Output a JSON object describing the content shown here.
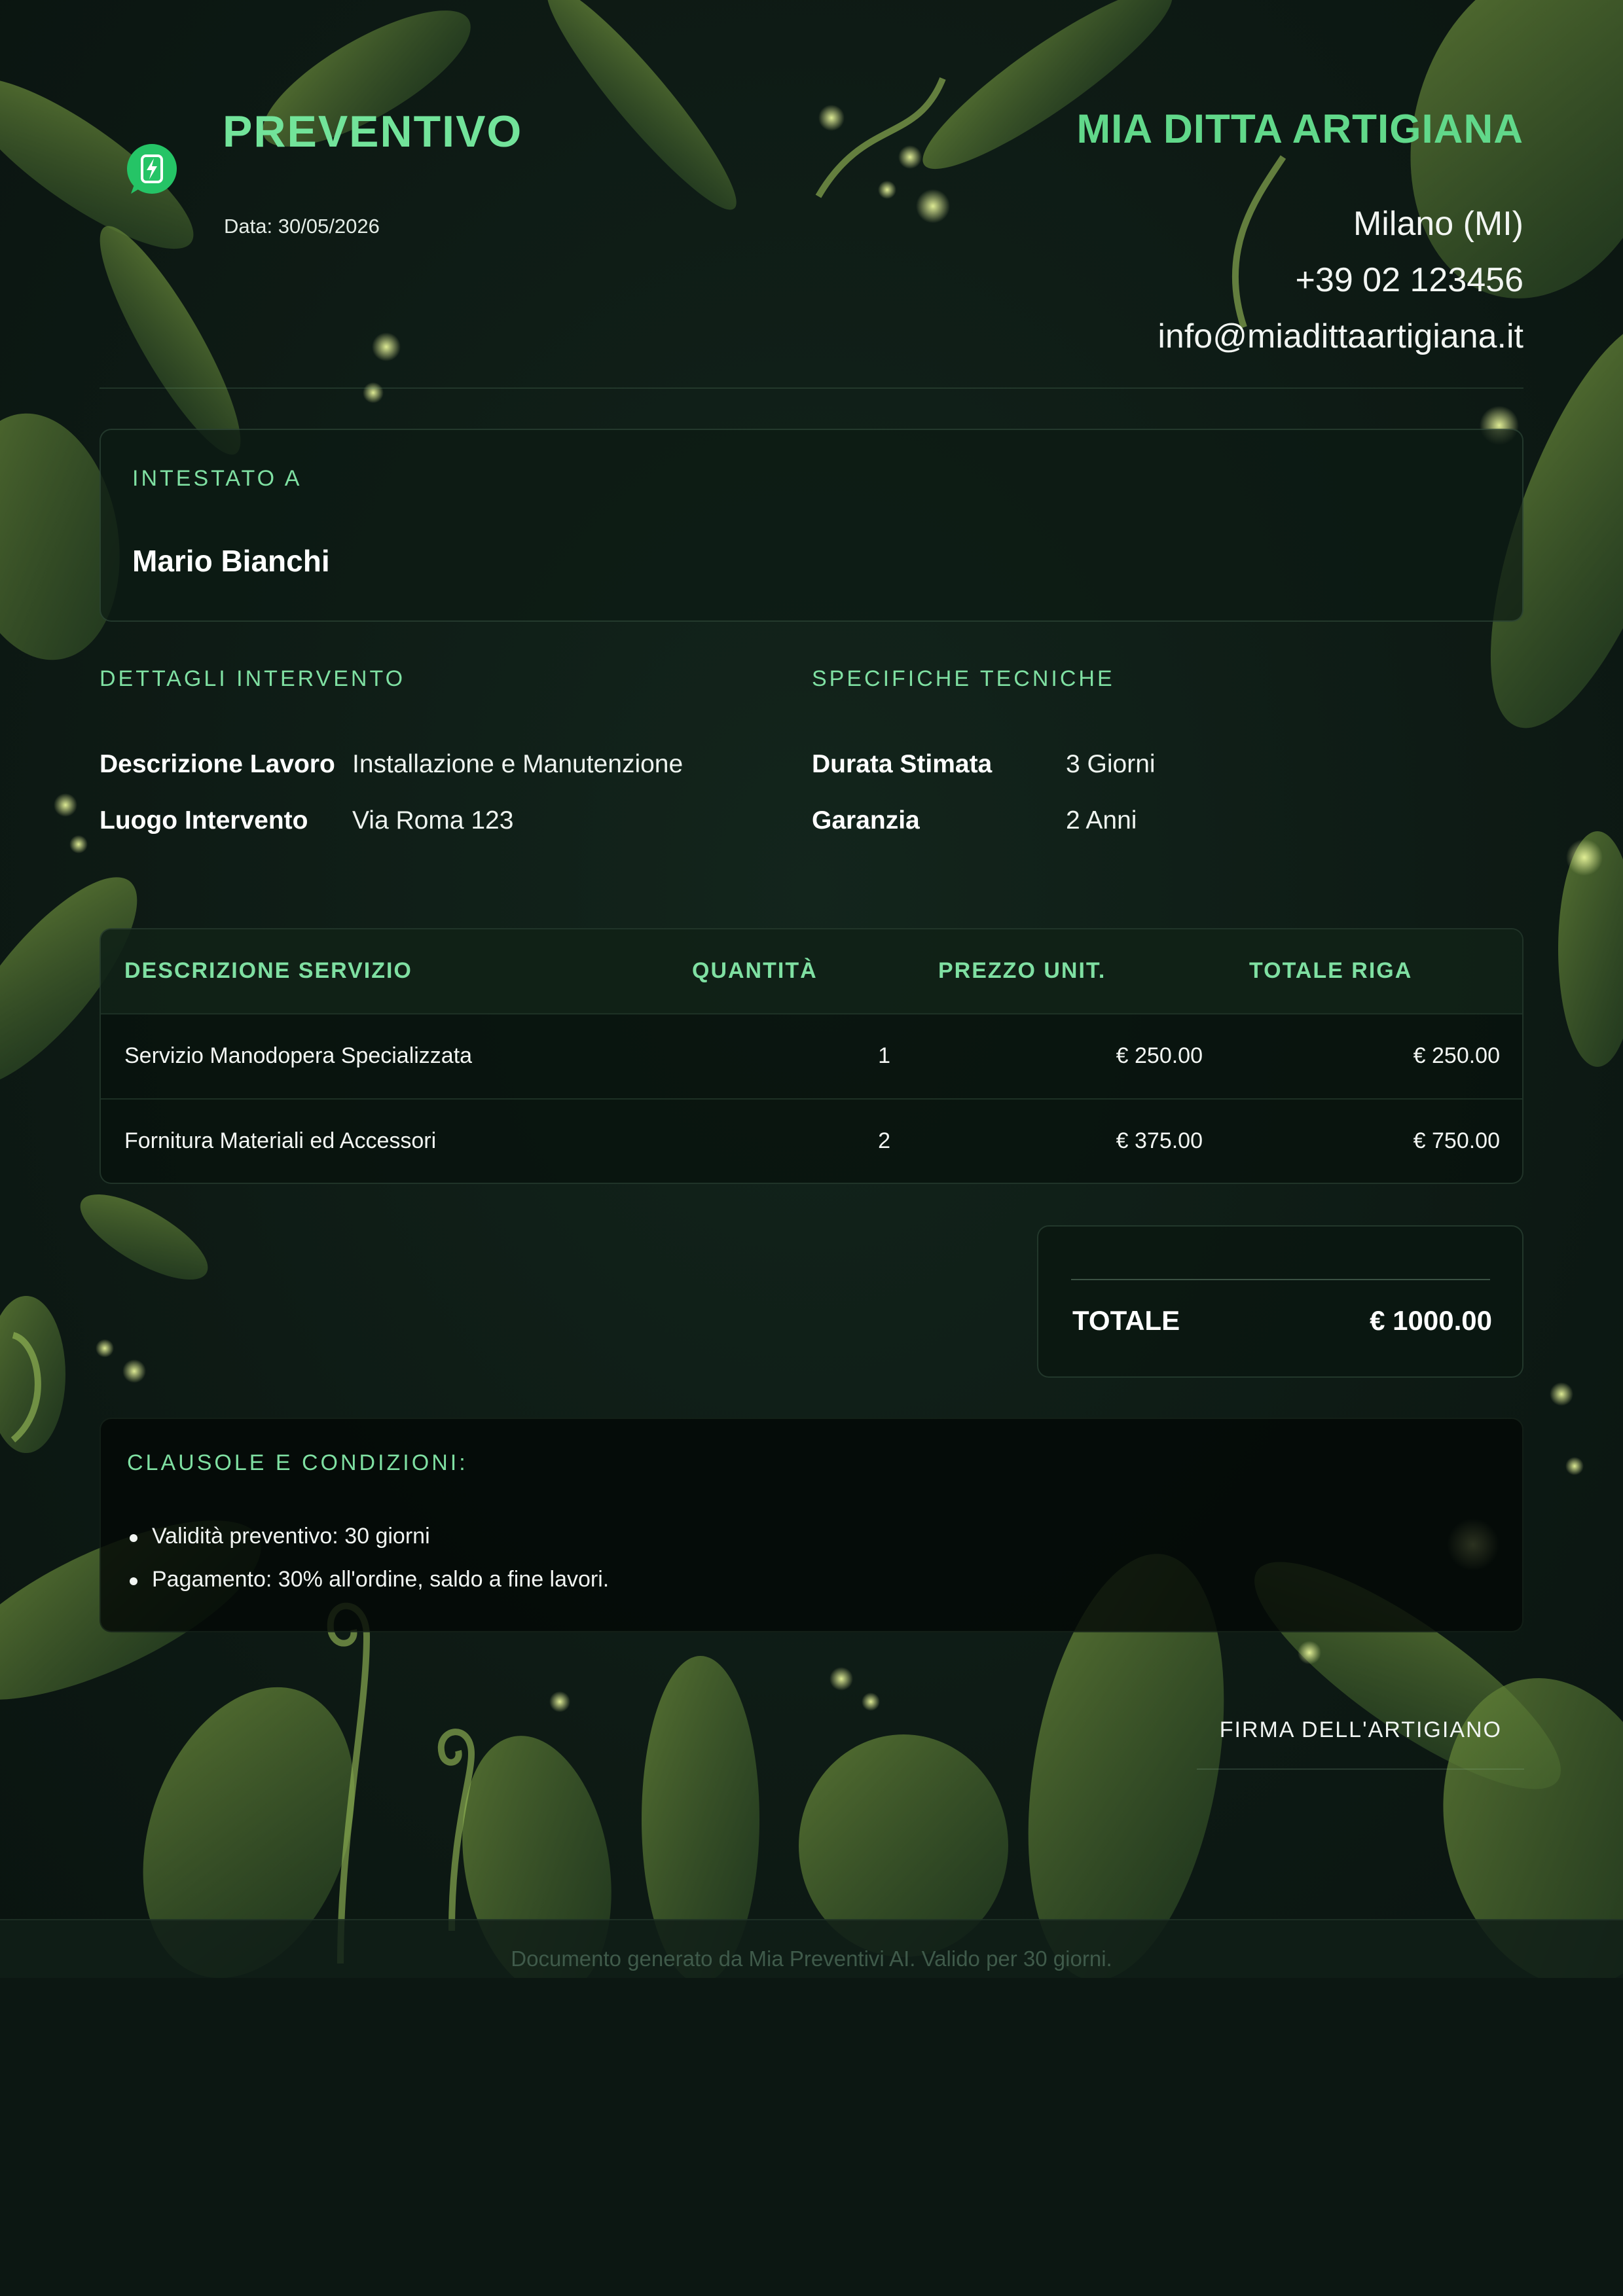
{
  "header": {
    "title": "PREVENTIVO",
    "date": "Data: 30/05/2026",
    "logo_icon": "whatsapp-bolt-icon"
  },
  "company": {
    "name": "MIA DITTA ARTIGIANA",
    "city": "Milano (MI)",
    "phone": "+39 02 123456",
    "email": "info@miadittaartigiana.it"
  },
  "client": {
    "label": "INTESTATO A",
    "name": "Mario Bianchi"
  },
  "details": {
    "label": "DETTAGLI INTERVENTO",
    "rows": [
      {
        "key": "Descrizione Lavoro",
        "value": "Installazione e Manutenzione"
      },
      {
        "key": "Luogo Intervento",
        "value": "Via Roma 123"
      }
    ]
  },
  "specs": {
    "label": "SPECIFICHE TECNICHE",
    "rows": [
      {
        "key": "Durata Stimata",
        "value": "3 Giorni"
      },
      {
        "key": "Garanzia",
        "value": "2 Anni"
      }
    ]
  },
  "table": {
    "headers": [
      "DESCRIZIONE SERVIZIO",
      "QUANTITÀ",
      "PREZZO UNIT.",
      "TOTALE RIGA"
    ],
    "rows": [
      {
        "desc": "Servizio Manodopera Specializzata",
        "qty": "1",
        "unit": "€ 250.00",
        "total": "€ 250.00"
      },
      {
        "desc": "Fornitura Materiali ed Accessori",
        "qty": "2",
        "unit": "€ 375.00",
        "total": "€ 750.00"
      }
    ]
  },
  "total": {
    "label": "TOTALE",
    "value": "€ 1000.00"
  },
  "clauses": {
    "label": "CLAUSOLE E CONDIZIONI:",
    "items": [
      "Validità preventivo: 30 giorni",
      "Pagamento: 30% all'ordine, saldo a fine lavori."
    ]
  },
  "signature": {
    "label": "FIRMA DELL'ARTIGIANO"
  },
  "footer": {
    "note": "Documento generato da Mia Preventivi AI. Valido per 30 giorni."
  },
  "colors": {
    "accent": "#72e39a",
    "background": "#0c1712"
  }
}
